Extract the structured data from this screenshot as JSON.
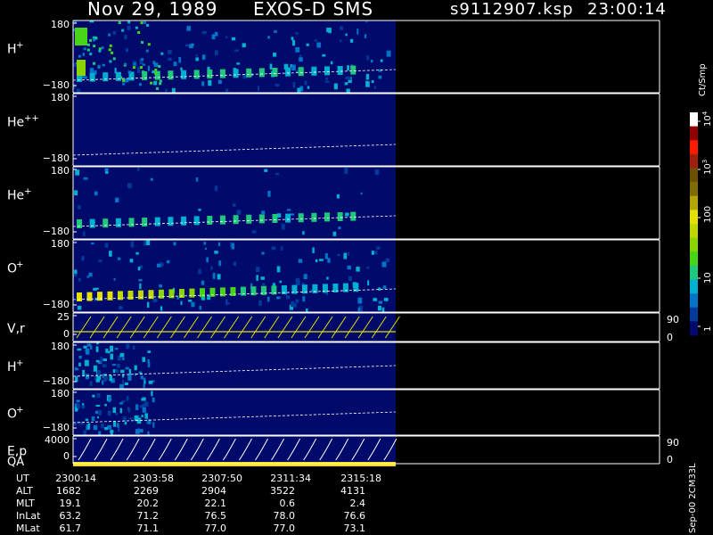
{
  "header": {
    "date": "Nov 29, 1989",
    "instrument": "EXOS-D SMS",
    "file": "s9112907.ksp",
    "time": "23:00:14"
  },
  "chart_data": {
    "type": "heatmap",
    "panels": [
      {
        "id": "h_plus",
        "label": "H",
        "sup": "+",
        "ymin_label": "−180",
        "ymax_label": "180",
        "intensity": "high_h"
      },
      {
        "id": "he_pp",
        "label": "He",
        "sup": "++",
        "ymin_label": "−180",
        "ymax_label": "180",
        "intensity": "none"
      },
      {
        "id": "he_plus",
        "label": "He",
        "sup": "+",
        "ymin_label": "−180",
        "ymax_label": "180",
        "intensity": "low"
      },
      {
        "id": "o_plus",
        "label": "O",
        "sup": "+",
        "ymin_label": "−180",
        "ymax_label": "180",
        "intensity": "o"
      },
      {
        "id": "vr",
        "label": "V,r",
        "sup": "",
        "ymin_label": "0",
        "ymax_label": "25",
        "right_top": "90",
        "right_bottom": "0",
        "kind": "line"
      },
      {
        "id": "h_plus2",
        "label": "H",
        "sup": "+",
        "ymin_label": "−180",
        "ymax_label": "180",
        "intensity": "med"
      },
      {
        "id": "o_plus2",
        "label": "O",
        "sup": "+",
        "ymin_label": "−180",
        "ymax_label": "180",
        "intensity": "med"
      },
      {
        "id": "ep",
        "label": "E,p",
        "sup": "",
        "ymin_label": "0",
        "ymax_label": "4000",
        "right_top": "90",
        "right_bottom": "0",
        "kind": "line2"
      }
    ],
    "qa_label": "QA",
    "colorbar": {
      "title": "Ct/Smp",
      "ticks": [
        "1",
        "10",
        "100",
        "10^3",
        "10^4"
      ]
    },
    "colorbar_colors": [
      "#000a6a",
      "#003a9a",
      "#0074c8",
      "#00b0d0",
      "#1ec87c",
      "#48d418",
      "#8cd400",
      "#c0d800",
      "#e6e000",
      "#b4a400",
      "#806c00",
      "#6c5000",
      "#a02010",
      "#ff1a00",
      "#900000",
      "#ffffff"
    ],
    "data_end_fraction": 0.55
  },
  "table": {
    "rows": [
      {
        "label": "UT",
        "values": [
          "2300:14",
          "2303:58",
          "2307:50",
          "2311:34",
          "2315:18"
        ]
      },
      {
        "label": "ALT",
        "values": [
          "1682",
          "2269",
          "2904",
          "3522",
          "4131"
        ]
      },
      {
        "label": "MLT",
        "values": [
          "19.1",
          "20.2",
          "22.1",
          "0.6",
          "2.4"
        ]
      },
      {
        "label": "InLat",
        "values": [
          "63.2",
          "71.2",
          "76.5",
          "78.0",
          "76.6"
        ]
      },
      {
        "label": "MLat",
        "values": [
          "61.7",
          "71.1",
          "77.0",
          "77.0",
          "73.1"
        ]
      }
    ]
  },
  "footer_vertical": "Sep-00 2CM33L"
}
